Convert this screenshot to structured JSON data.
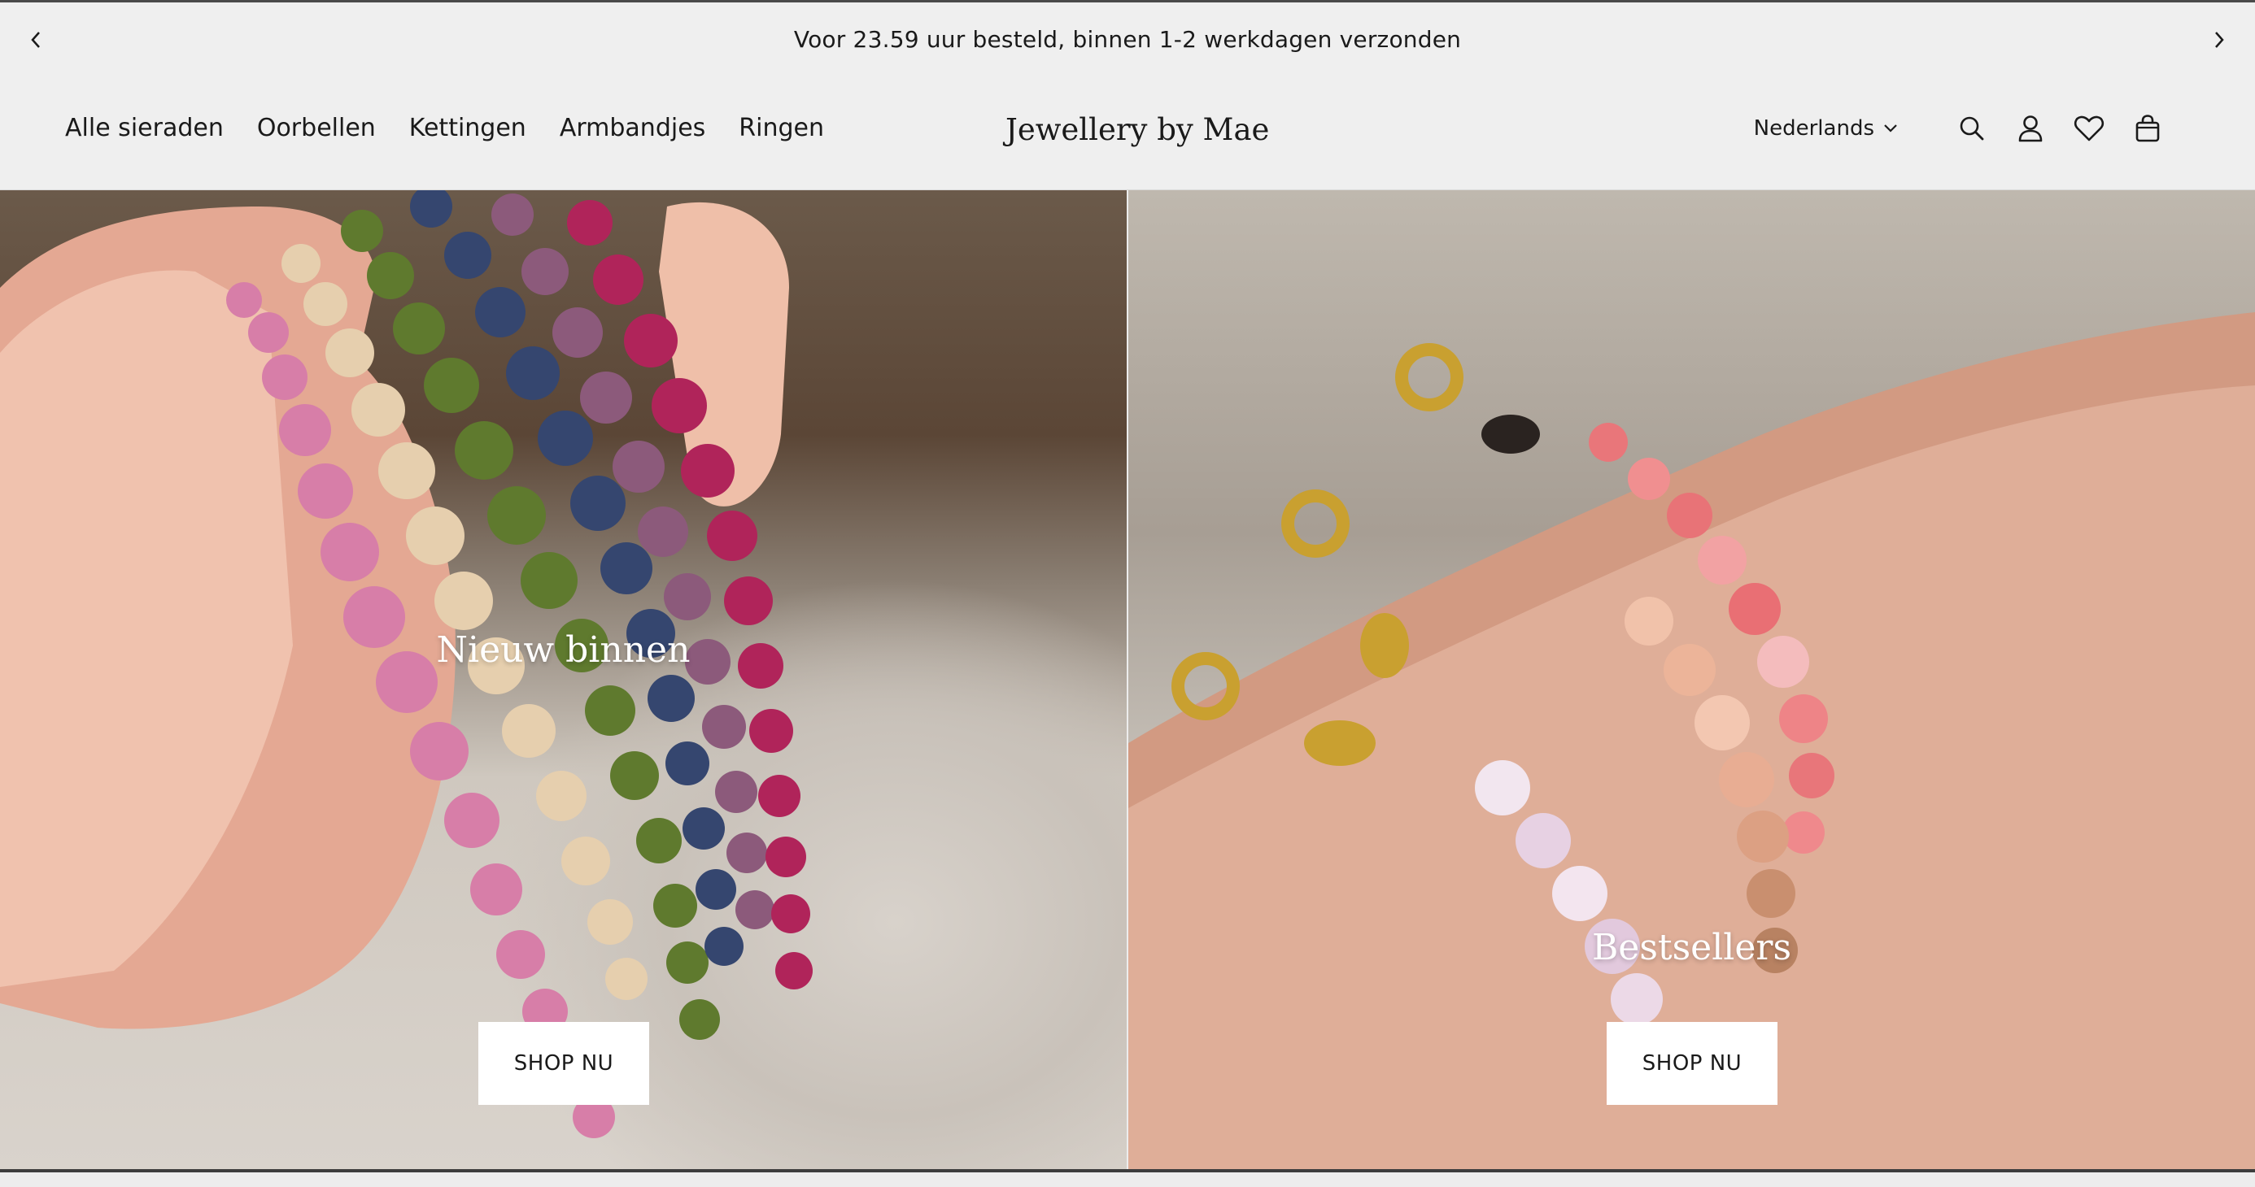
{
  "announcement": {
    "text": "Voor 23.59 uur besteld, binnen 1-2 werkdagen verzonden",
    "prev_icon": "chevron-left-icon",
    "next_icon": "chevron-right-icon"
  },
  "header": {
    "nav": [
      {
        "label": "Alle sieraden"
      },
      {
        "label": "Oorbellen"
      },
      {
        "label": "Kettingen"
      },
      {
        "label": "Armbandjes"
      },
      {
        "label": "Ringen"
      }
    ],
    "logo": "Jewellery by Mae",
    "language": "Nederlands",
    "icons": [
      "search-icon",
      "account-icon",
      "heart-icon",
      "bag-icon"
    ]
  },
  "hero": {
    "panels": [
      {
        "title": "Nieuw binnen",
        "button": "SHOP NU",
        "image": "colored-bead-bracelets-in-hand"
      },
      {
        "title": "Bestsellers",
        "button": "SHOP NU",
        "image": "gemstone-bracelets-on-wrist"
      }
    ]
  },
  "colors": {
    "background": "#efefef",
    "text": "#1a1a1a",
    "button_bg": "#ffffff"
  }
}
